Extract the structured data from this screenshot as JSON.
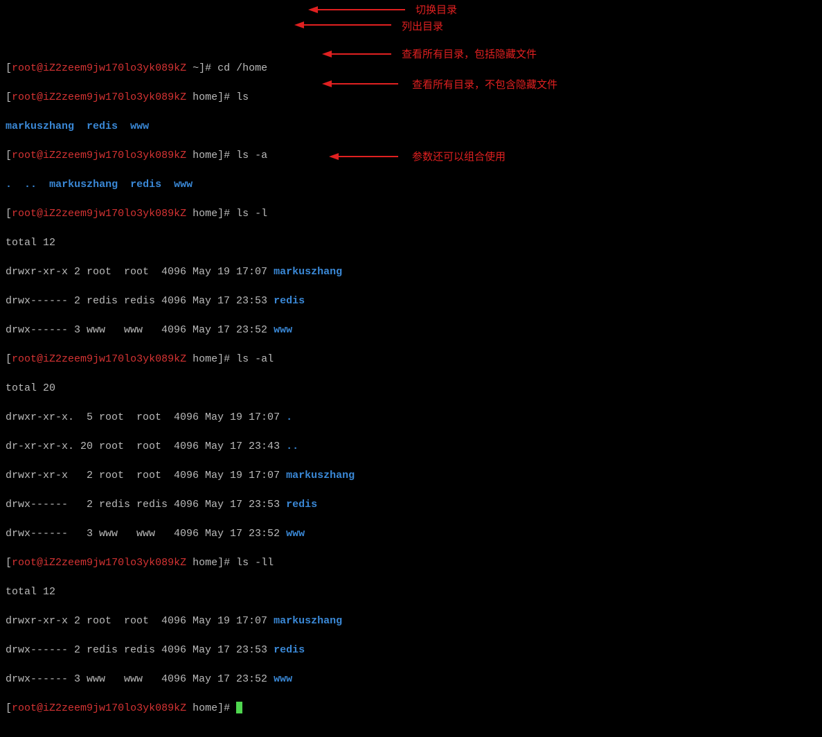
{
  "prompt": {
    "user": "root",
    "host": "iZ2zeem9jw170lo3yk089kZ",
    "home_prompt": "[root@iZ2zeem9jw170lo3yk089kZ home]#",
    "root_prompt": "[root@iZ2zeem9jw170lo3yk089kZ ~]#"
  },
  "lines": {
    "l0_cmd": "cd /home",
    "l1_cmd": "ls",
    "l2_d1": "markuszhang",
    "l2_d2": "redis",
    "l2_d3": "www",
    "l3_cmd": "ls -a",
    "l4_d1": ".",
    "l4_d2": "..",
    "l4_d3": "markuszhang",
    "l4_d4": "redis",
    "l4_d5": "www",
    "l5_cmd": "ls -l",
    "l6": "total 12",
    "l7_perm": "drwxr-xr-x 2 root  root  4096 May 19 17:07 ",
    "l7_dir": "markuszhang",
    "l8_perm": "drwx------ 2 redis redis 4096 May 17 23:53 ",
    "l8_dir": "redis",
    "l9_perm": "drwx------ 3 www   www   4096 May 17 23:52 ",
    "l9_dir": "www",
    "l10_cmd": "ls -al",
    "l11": "total 20",
    "l12_perm": "drwxr-xr-x.  5 root  root  4096 May 19 17:07 ",
    "l12_dir": ".",
    "l13_perm": "dr-xr-xr-x. 20 root  root  4096 May 17 23:43 ",
    "l13_dir": "..",
    "l14_perm": "drwxr-xr-x   2 root  root  4096 May 19 17:07 ",
    "l14_dir": "markuszhang",
    "l15_perm": "drwx------   2 redis redis 4096 May 17 23:53 ",
    "l15_dir": "redis",
    "l16_perm": "drwx------   3 www   www   4096 May 17 23:52 ",
    "l16_dir": "www",
    "l17_cmd": "ls -ll",
    "l18": "total 12",
    "l19_perm": "drwxr-xr-x 2 root  root  4096 May 19 17:07 ",
    "l19_dir": "markuszhang",
    "l20_perm": "drwx------ 2 redis redis 4096 May 17 23:53 ",
    "l20_dir": "redis",
    "l21_perm": "drwx------ 3 www   www   4096 May 17 23:52 ",
    "l21_dir": "www"
  },
  "annotations": {
    "a1": "切换目录",
    "a2": "列出目录",
    "a3": "查看所有目录，包括隐藏文件",
    "a4": "查看所有目录，不包含隐藏文件",
    "a5": "参数还可以组合使用"
  }
}
